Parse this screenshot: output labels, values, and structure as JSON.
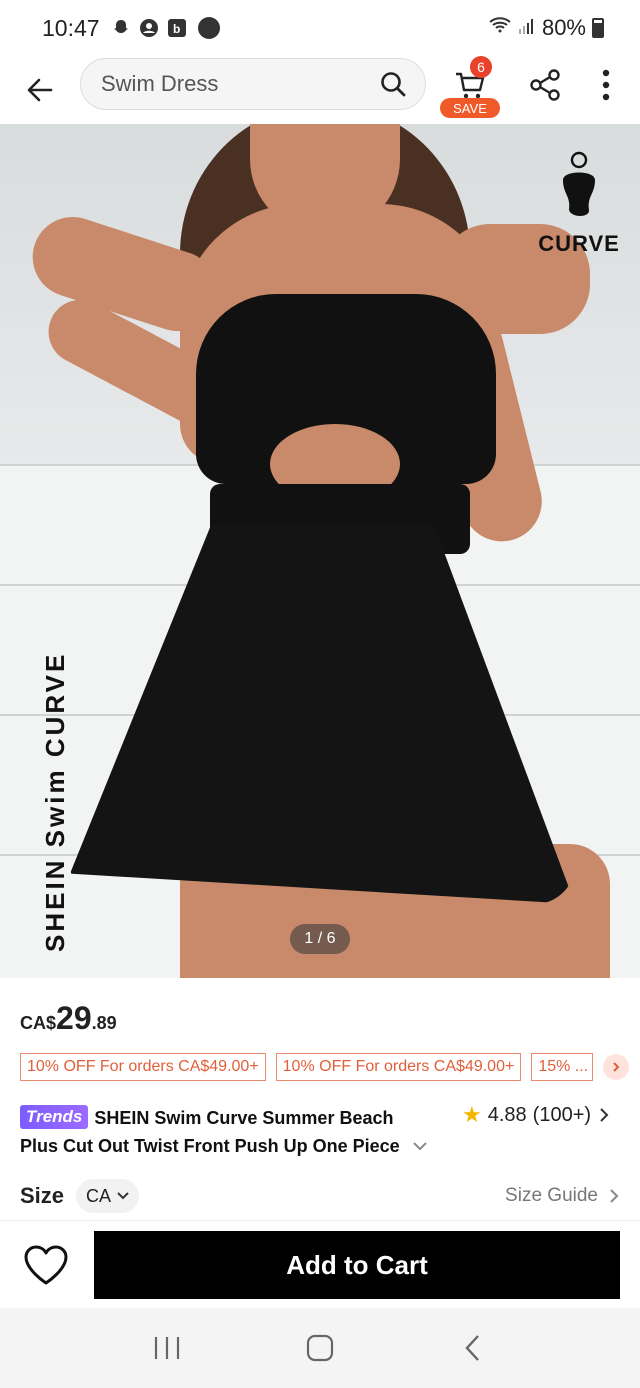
{
  "status_bar": {
    "time": "10:47",
    "battery": "80%"
  },
  "top_nav": {
    "search_text": "Swim Dress",
    "cart_count": "6",
    "save_label": "SAVE"
  },
  "product_image": {
    "logo_text": "CURVE",
    "brand_vertical": "SHEIN Swim CURVE",
    "counter": "1 / 6"
  },
  "price": {
    "currency": "CA$",
    "whole": "29",
    "cents": ".89"
  },
  "coupons": [
    {
      "label": "10% OFF For orders CA$49.00+"
    },
    {
      "label": "10% OFF For orders CA$49.00+"
    },
    {
      "label": "15% ..."
    }
  ],
  "title": {
    "badge": "Trends",
    "line1": "SHEIN Swim Curve Summer Beach",
    "line2": "Plus Cut Out Twist Front Push Up One Piece"
  },
  "rating": {
    "value": "4.88",
    "count": "(100+)"
  },
  "size": {
    "label": "Size",
    "selected": "CA",
    "guide": "Size Guide"
  },
  "actions": {
    "add_to_cart": "Add to Cart"
  },
  "colors": {
    "accent": "#e0603b",
    "badge": "#e8422b",
    "trends": "#7c5cff",
    "star": "#f5b400"
  }
}
